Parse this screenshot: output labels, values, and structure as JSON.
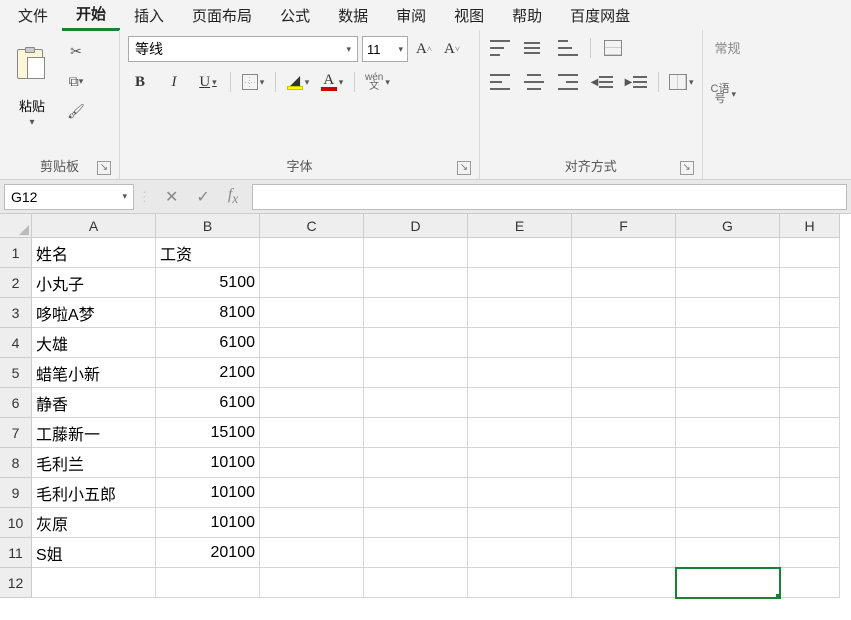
{
  "menu": {
    "tabs": [
      "文件",
      "开始",
      "插入",
      "页面布局",
      "公式",
      "数据",
      "审阅",
      "视图",
      "帮助",
      "百度网盘"
    ],
    "active_index": 1
  },
  "ribbon": {
    "clipboard": {
      "paste": "粘贴",
      "label": "剪贴板"
    },
    "font": {
      "name": "等线",
      "size": "11",
      "label": "字体",
      "phonetic_top": "wén",
      "phonetic_bottom": "文"
    },
    "align": {
      "label": "对齐方式"
    },
    "number": {
      "format": "常规",
      "currency_top": "C语",
      "currency_bottom": "号"
    }
  },
  "formula_bar": {
    "cell_ref": "G12",
    "formula": ""
  },
  "grid": {
    "columns": [
      "A",
      "B",
      "C",
      "D",
      "E",
      "F",
      "G",
      "H"
    ],
    "headers": {
      "A": "姓名",
      "B": "工资"
    },
    "rows": [
      {
        "A": "小丸子",
        "B": 5100
      },
      {
        "A": "哆啦A梦",
        "B": 8100
      },
      {
        "A": "大雄",
        "B": 6100
      },
      {
        "A": "蜡笔小新",
        "B": 2100
      },
      {
        "A": "静香",
        "B": 6100
      },
      {
        "A": "工藤新一",
        "B": 15100
      },
      {
        "A": "毛利兰",
        "B": 10100
      },
      {
        "A": "毛利小五郎",
        "B": 10100
      },
      {
        "A": "灰原",
        "B": 10100
      },
      {
        "A": "S姐",
        "B": 20100
      }
    ],
    "selected": "G12",
    "visible_rows": 12
  },
  "chart_data": {
    "type": "table",
    "title": "",
    "columns": [
      "姓名",
      "工资"
    ],
    "rows": [
      [
        "小丸子",
        5100
      ],
      [
        "哆啦A梦",
        8100
      ],
      [
        "大雄",
        6100
      ],
      [
        "蜡笔小新",
        2100
      ],
      [
        "静香",
        6100
      ],
      [
        "工藤新一",
        15100
      ],
      [
        "毛利兰",
        10100
      ],
      [
        "毛利小五郎",
        10100
      ],
      [
        "灰原",
        10100
      ],
      [
        "S姐",
        20100
      ]
    ]
  }
}
